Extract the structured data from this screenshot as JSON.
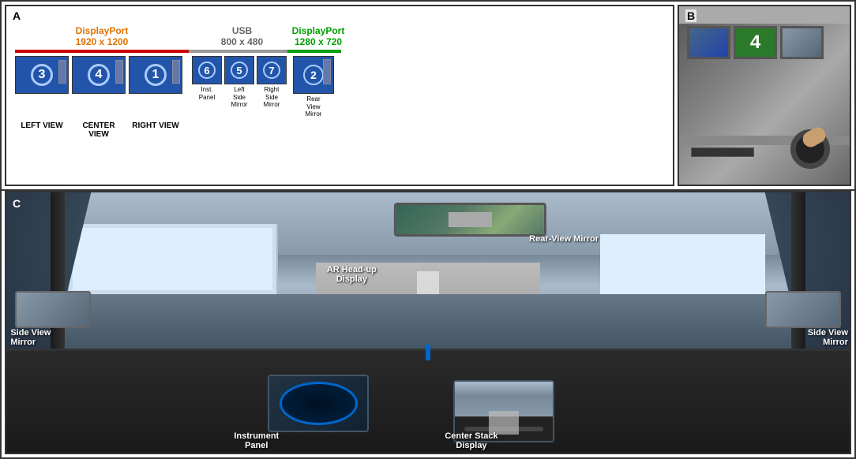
{
  "panels": {
    "a": {
      "label": "A",
      "displayport_left": {
        "name": "DisplayPort",
        "resolution": "1920 x 1200"
      },
      "usb": {
        "name": "USB",
        "resolution": "800 x 480"
      },
      "displayport_right": {
        "name": "DisplayPort",
        "resolution": "1280 x 720"
      },
      "screens": [
        {
          "number": "3",
          "label": "LEFT VIEW"
        },
        {
          "number": "4",
          "label": "CENTER VIEW"
        },
        {
          "number": "1",
          "label": "RIGHT VIEW"
        }
      ],
      "usb_screens": [
        {
          "number": "6",
          "sublabel": "Inst.\nPanel"
        },
        {
          "number": "5",
          "sublabel": "Left\nSide\nMirror"
        },
        {
          "number": "7",
          "sublabel": "Right\nSide\nMirror"
        }
      ],
      "rear_mirror_screen": {
        "number": "2",
        "sublabel": "Rear\nView\nMirror"
      }
    },
    "b": {
      "label": "B",
      "number_display": "4"
    },
    "c": {
      "label": "C",
      "annotations": {
        "ar_hud": "AR Head-up\nDisplay",
        "rear_mirror": "Rear-View Mirror",
        "side_left": "Side View\nMirror",
        "side_right": "Side View\nMirror",
        "instrument": "Instrument\nPanel",
        "center_stack": "Center Stack\nDisplay"
      }
    }
  }
}
